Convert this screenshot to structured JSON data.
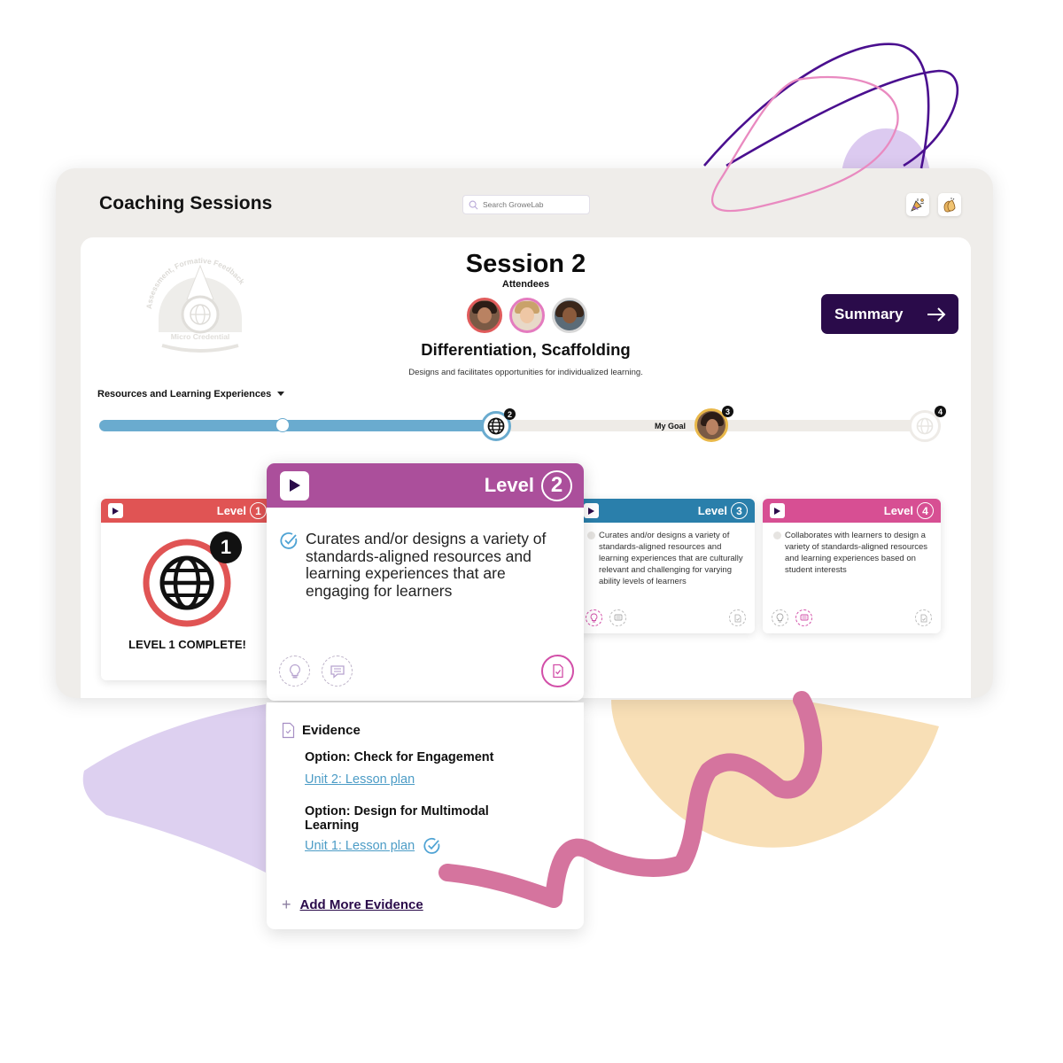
{
  "app": {
    "title": "Coaching Sessions",
    "search_placeholder": "Search GroweLab",
    "top_icons": [
      "party-popper-icon",
      "clapping-hands-icon"
    ]
  },
  "badge": {
    "arc_text": "Assessment, Formative Feedback",
    "label": "Micro Credential"
  },
  "session": {
    "title": "Session 2",
    "attendees_label": "Attendees",
    "attendees_count": 3,
    "competency": "Differentiation, Scaffolding",
    "description": "Designs and facilitates opportunities for individualized learning.",
    "summary_label": "Summary"
  },
  "filter": {
    "selected": "Resources and Learning Experiences"
  },
  "progress": {
    "current_level": 2,
    "goal_level": 3,
    "goal_label": "My Goal",
    "milestones": [
      "1",
      "2",
      "3",
      "4"
    ]
  },
  "levels": [
    {
      "label": "Level",
      "number": "1",
      "color": "#e05454",
      "complete_text": "LEVEL 1 COMPLETE!",
      "badge_number": "1"
    },
    {
      "label": "Level",
      "number": "2",
      "color": "#ab4f9b",
      "text": "Curates and/or designs a variety of standards-aligned resources and learning experiences that are engaging for learners",
      "checked": true
    },
    {
      "label": "Level",
      "number": "3",
      "color": "#2a7fab",
      "text": "Curates and/or designs a variety of standards-aligned resources and learning experiences that are culturally relevant and challenging for varying ability levels of learners",
      "checked": false
    },
    {
      "label": "Level",
      "number": "4",
      "color": "#d74f93",
      "text": "Collaborates with learners to design a variety of standards-aligned resources and learning experiences based on student interests",
      "checked": false
    }
  ],
  "evidence": {
    "heading": "Evidence",
    "options": [
      {
        "title": "Option: Check for Engagement",
        "link": "Unit 2: Lesson plan",
        "verified": false
      },
      {
        "title": "Option: Design for Multimodal Learning",
        "link": "Unit 1: Lesson plan",
        "verified": true
      }
    ],
    "add_label": "Add More Evidence"
  }
}
